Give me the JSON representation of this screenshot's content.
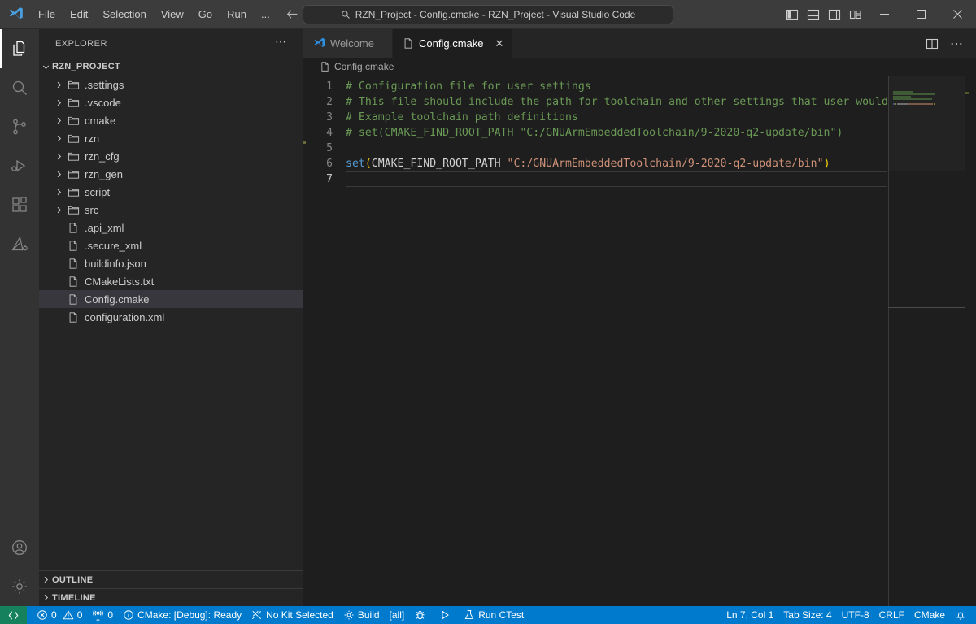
{
  "titlebar": {
    "logo_icon": "vscode-logo-icon",
    "menus": [
      "File",
      "Edit",
      "Selection",
      "View",
      "Go",
      "Run",
      "..."
    ],
    "back_icon": "arrow-left-icon",
    "forward_icon": "arrow-right-icon",
    "command_center": {
      "search_icon": "search-icon",
      "text": "RZN_Project - Config.cmake - RZN_Project - Visual Studio Code"
    },
    "layout_buttons": [
      {
        "name": "toggle-primary-sidebar-icon",
        "title": "Toggle Primary Side Bar"
      },
      {
        "name": "toggle-panel-icon",
        "title": "Toggle Panel"
      },
      {
        "name": "toggle-secondary-sidebar-icon",
        "title": "Toggle Secondary Side Bar"
      },
      {
        "name": "customize-layout-icon",
        "title": "Customize Layout"
      }
    ],
    "window_buttons": [
      {
        "name": "minimize-button",
        "glyph": "—"
      },
      {
        "name": "maximize-button",
        "glyph": "□"
      },
      {
        "name": "close-button",
        "glyph": "✕"
      }
    ]
  },
  "activitybar": {
    "items": [
      {
        "name": "activity-explorer",
        "icon": "files-icon",
        "active": true
      },
      {
        "name": "activity-search",
        "icon": "search-icon",
        "active": false
      },
      {
        "name": "activity-source-control",
        "icon": "source-control-icon",
        "active": false
      },
      {
        "name": "activity-run-debug",
        "icon": "run-and-debug-icon",
        "active": false
      },
      {
        "name": "activity-extensions",
        "icon": "extensions-icon",
        "active": false
      },
      {
        "name": "activity-cmake",
        "icon": "cmake-icon",
        "active": false
      }
    ],
    "bottom": [
      {
        "name": "activity-accounts",
        "icon": "account-icon"
      },
      {
        "name": "activity-settings",
        "icon": "gear-icon"
      }
    ]
  },
  "sidebar": {
    "title": "EXPLORER",
    "more_actions": "⋯",
    "root": {
      "label": "RZN_PROJECT",
      "expanded": true
    },
    "tree": [
      {
        "label": ".settings",
        "type": "folder",
        "expanded": false,
        "selected": false
      },
      {
        "label": ".vscode",
        "type": "folder",
        "expanded": false,
        "selected": false
      },
      {
        "label": "cmake",
        "type": "folder",
        "expanded": false,
        "selected": false
      },
      {
        "label": "rzn",
        "type": "folder",
        "expanded": false,
        "selected": false
      },
      {
        "label": "rzn_cfg",
        "type": "folder",
        "expanded": false,
        "selected": false
      },
      {
        "label": "rzn_gen",
        "type": "folder",
        "expanded": false,
        "selected": false
      },
      {
        "label": "script",
        "type": "folder",
        "expanded": false,
        "selected": false
      },
      {
        "label": "src",
        "type": "folder",
        "expanded": false,
        "selected": false
      },
      {
        "label": ".api_xml",
        "type": "file",
        "expanded": false,
        "selected": false
      },
      {
        "label": ".secure_xml",
        "type": "file",
        "expanded": false,
        "selected": false
      },
      {
        "label": "buildinfo.json",
        "type": "file",
        "expanded": false,
        "selected": false
      },
      {
        "label": "CMakeLists.txt",
        "type": "file",
        "expanded": false,
        "selected": false
      },
      {
        "label": "Config.cmake",
        "type": "file",
        "expanded": false,
        "selected": true
      },
      {
        "label": "configuration.xml",
        "type": "file",
        "expanded": false,
        "selected": false
      }
    ],
    "sections": [
      {
        "label": "OUTLINE",
        "expanded": false
      },
      {
        "label": "TIMELINE",
        "expanded": false
      }
    ]
  },
  "editor": {
    "tabs": [
      {
        "label": "Welcome",
        "icon": "vscode-logo-icon",
        "active": false,
        "closable": false
      },
      {
        "label": "Config.cmake",
        "icon": "file-icon",
        "active": true,
        "closable": true,
        "close_glyph": "✕"
      }
    ],
    "tab_actions": [
      {
        "name": "split-editor-right-icon"
      },
      {
        "name": "more-actions-icon",
        "glyph": "⋯"
      }
    ],
    "breadcrumb": {
      "icon": "file-icon",
      "label": "Config.cmake"
    },
    "line_numbers": [
      "1",
      "2",
      "3",
      "4",
      "5",
      "6",
      "7"
    ],
    "current_line": 7,
    "lines": [
      {
        "n": 1,
        "tokens": [
          {
            "t": "# Configuration file for user settings",
            "c": "cm"
          }
        ]
      },
      {
        "n": 2,
        "tokens": [
          {
            "t": "# This file should include the path for toolchain and other settings that user would",
            "c": "cm"
          }
        ]
      },
      {
        "n": 3,
        "tokens": [
          {
            "t": "# Example toolchain path definitions",
            "c": "cm"
          }
        ]
      },
      {
        "n": 4,
        "tokens": [
          {
            "t": "# set(CMAKE_FIND_ROOT_PATH \"C:/GNUArmEmbeddedToolchain/9-2020-q2-update/bin\")",
            "c": "cm"
          }
        ]
      },
      {
        "n": 5,
        "tokens": []
      },
      {
        "n": 6,
        "tokens": [
          {
            "t": "set",
            "c": "fn"
          },
          {
            "t": "(",
            "c": "pa"
          },
          {
            "t": "CMAKE_FIND_ROOT_PATH ",
            "c": "id"
          },
          {
            "t": "\"C:/GNUArmEmbeddedToolchain/9-2020-q2-update/bin\"",
            "c": "st"
          },
          {
            "t": ")",
            "c": "pa"
          }
        ]
      },
      {
        "n": 7,
        "tokens": []
      }
    ]
  },
  "statusbar": {
    "remote_icon": "remote-window-icon",
    "left_items": [
      {
        "name": "problems-status",
        "icon": "error-icon",
        "label": "0",
        "icon2": "warning-icon",
        "label2": "0"
      },
      {
        "name": "ports-status",
        "icon": "radio-tower-icon",
        "label": "0"
      },
      {
        "name": "cmake-status",
        "icon": "info-icon",
        "label": "CMake: [Debug]: Ready"
      },
      {
        "name": "kit-status",
        "icon": "tools-icon",
        "label": "No Kit Selected"
      },
      {
        "name": "build-status",
        "icon": "gear-icon",
        "label": "Build"
      },
      {
        "name": "build-target-status",
        "icon": "",
        "label": "[all]"
      },
      {
        "name": "debug-status",
        "icon": "debug-icon",
        "label": ""
      },
      {
        "name": "launch-status",
        "icon": "play-icon",
        "label": ""
      },
      {
        "name": "ctest-status",
        "icon": "beaker-icon",
        "label": "Run CTest"
      }
    ],
    "right_items": [
      {
        "name": "cursor-position-status",
        "label": "Ln 7, Col 1"
      },
      {
        "name": "indentation-status",
        "label": "Tab Size: 4"
      },
      {
        "name": "encoding-status",
        "label": "UTF-8"
      },
      {
        "name": "eol-status",
        "label": "CRLF"
      },
      {
        "name": "language-mode-status",
        "label": "CMake"
      },
      {
        "name": "notifications-status",
        "icon": "bell-icon",
        "label": ""
      }
    ]
  },
  "colors": {
    "titlebar_bg": "#3c3c3c",
    "activitybar_bg": "#333333",
    "sidebar_bg": "#252526",
    "editor_bg": "#1e1e1e",
    "statusbar_bg": "#007acc",
    "remote_bg": "#16825d",
    "selection_bg": "#37373d",
    "comment": "#6A9955",
    "function": "#569CD6",
    "string": "#CE9178",
    "paren": "#ffd700"
  }
}
